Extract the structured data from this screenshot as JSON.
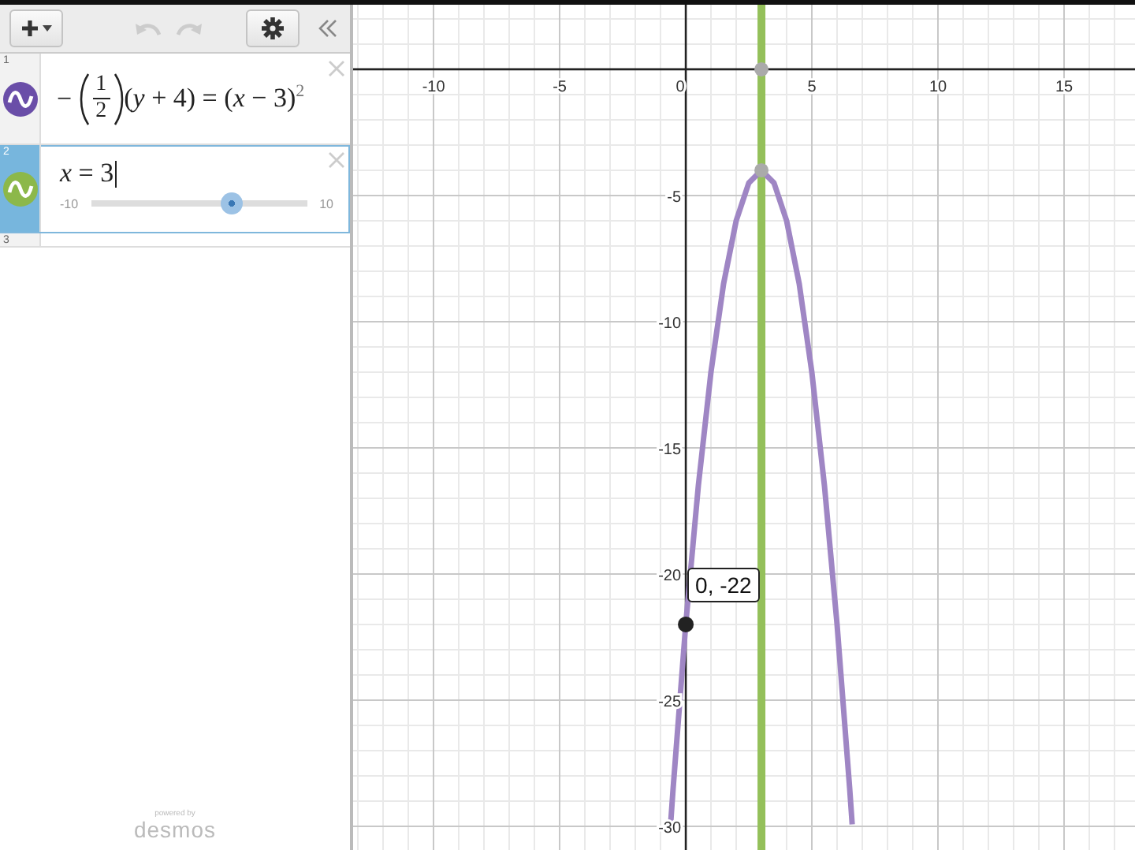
{
  "toolbar": {
    "add_button": {
      "expanded": false
    },
    "undo": {
      "disabled": true
    },
    "redo": {
      "disabled": true
    }
  },
  "expressions": [
    {
      "index": "1",
      "kind": "fraction",
      "selected": false,
      "color": "#6a4ea8",
      "prefix": "−",
      "numerator": "1",
      "denominator": "2",
      "suffix": "(*y* + 4) = (*x* − 3)$^{2}$"
    },
    {
      "index": "2",
      "kind": "slider",
      "selected": true,
      "color": "#8cb84a",
      "text": "*x* = 3",
      "slider": {
        "min": "-10",
        "max": "10",
        "level": 0.65
      }
    },
    {
      "index": "3",
      "kind": "empty",
      "selected": false
    }
  ],
  "branding": {
    "small": "powered by",
    "name": "desmos"
  },
  "graph": {
    "chart_data": {
      "type": "line",
      "xlim": [
        -13.19,
        17.81
      ],
      "ylim": [
        -30.94,
        2.56
      ],
      "xticks": [
        -10,
        -5,
        0,
        5,
        10,
        15
      ],
      "yticks": [
        -5,
        -10,
        -15,
        -20,
        -25,
        -30
      ],
      "x": [
        -0.6,
        -0.5,
        0,
        0.5,
        1,
        1.5,
        2,
        2.5,
        3,
        3.5,
        4,
        4.5,
        5,
        5.5,
        6,
        6.5,
        6.6
      ],
      "series": [
        {
          "color": "#9f86c4",
          "values": [
            -29.92,
            -28.5,
            -22,
            -16.5,
            -12,
            -8.5,
            -6,
            -4.5,
            -4,
            -4.5,
            -6,
            -8.5,
            -12,
            -16.5,
            -22,
            -28.5,
            -29.92
          ]
        },
        {
          "color": "#aaaaaa",
          "marker": true,
          "values": [
            null,
            null,
            null,
            null,
            null,
            null,
            null,
            null,
            0,
            null,
            null,
            null,
            null,
            null,
            null,
            null,
            null
          ]
        }
      ],
      "grid": true,
      "ref_lines": [
        {
          "axis": "x",
          "value": 3,
          "color": "#94c05a"
        }
      ],
      "annotations": [
        {
          "x": 0,
          "y": -22,
          "text": "0, -22"
        }
      ]
    }
  }
}
